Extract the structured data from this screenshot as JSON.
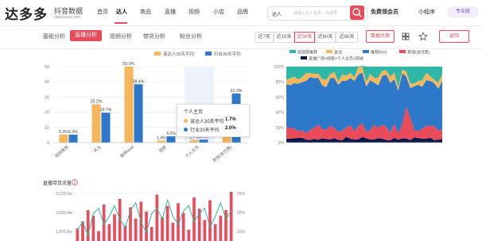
{
  "brand": {
    "name": "达多多",
    "sub": "抖音数据",
    "url": "daduoduo.com"
  },
  "nav": {
    "items": [
      {
        "label": "首页"
      },
      {
        "label": "达人"
      },
      {
        "label": "商品"
      },
      {
        "label": "直播"
      },
      {
        "label": "视频"
      },
      {
        "label": "小店"
      },
      {
        "label": "品牌"
      }
    ]
  },
  "search": {
    "type": "达人",
    "placeholder": "请输入达人名称、抖音号"
  },
  "header_right": {
    "vip": "免费领会员",
    "mini": "小程序",
    "pro": "专业版"
  },
  "tabs": [
    {
      "label": "基础分析"
    },
    {
      "label": "直播分析"
    },
    {
      "label": "视频分析"
    },
    {
      "label": "带货分析"
    },
    {
      "label": "粉丝分析"
    }
  ],
  "ranges": [
    {
      "label": "近7天"
    },
    {
      "label": "近15天"
    },
    {
      "label": "近30天"
    },
    {
      "label": "近60天"
    },
    {
      "label": "近90天"
    }
  ],
  "toolbar": {
    "bigscreen": "数据大屏",
    "return": "返回"
  },
  "colors": {
    "accent": "#e94b5b",
    "orange": "#f5b65c",
    "blue": "#2d78c8"
  },
  "tooltip": {
    "title": "个人主页",
    "rows": [
      {
        "name": "该达人30天平均",
        "value": "1.7%",
        "color": "#f5b65c"
      },
      {
        "name": "行业30天平均",
        "value": "2.0%",
        "color": "#2d78c8"
      }
    ]
  },
  "section": {
    "traffic_title": "直播带货流量",
    "watermark": "达多多"
  },
  "chart_data": [
    {
      "type": "bar",
      "legend": [
        "该达人30天平均",
        "行业30天平均"
      ],
      "categories": [
        "视频推荐",
        "关注",
        "推荐feed",
        "搜索",
        "个人主页",
        "其他(含付费)"
      ],
      "series": [
        {
          "name": "该达人30天平均",
          "values": [
            5.3,
            25.2,
            50.0,
            1.4,
            1.7,
            14.3
          ]
        },
        {
          "name": "行业30天平均",
          "values": [
            5.3,
            19.7,
            38.4,
            4.2,
            2.0,
            32.3
          ]
        }
      ],
      "labels": [
        [
          "5.3%",
          "25.2%",
          "50.0%",
          "1.4%",
          "1.7%",
          "14.3%"
        ],
        [
          "5.3%",
          "19.7%",
          "38.4%",
          "4.2%",
          "2.0%",
          "32.3%"
        ]
      ],
      "ylim": [
        0,
        50
      ],
      "yticks": [
        0,
        10,
        20,
        30,
        40,
        50
      ]
    },
    {
      "type": "area",
      "stacked": true,
      "yticks": [
        "0%",
        "20%",
        "40%",
        "60%",
        "80%",
        "100%"
      ],
      "series": [
        {
          "name": "直播广场",
          "color": "#0d1b4a"
        },
        {
          "name": "推荐feed",
          "color": "#e94b5b"
        },
        {
          "name": "其他",
          "color": "#2d78c8"
        },
        {
          "name": "关注",
          "color": "#f5b65c"
        },
        {
          "name": "视频推荐",
          "color": "#2fb7a8"
        }
      ],
      "legend_rows": [
        [
          "短视频推荐",
          "关注",
          "推荐feed",
          "其他(含付费)"
        ],
        [
          "直播广场+搜索+个人主页+同城"
        ]
      ]
    },
    {
      "type": "bar+line",
      "title": "直播带货流量",
      "y_left_ticks": [
        "3,129.0w",
        "2,502.4w",
        "1,876.8w"
      ],
      "y_right_ticks": [
        "25%",
        "20%",
        "15%"
      ],
      "bars": [
        9,
        14,
        22,
        18,
        7,
        26,
        12,
        19,
        30,
        11,
        24,
        16,
        28,
        21,
        10,
        33,
        17,
        25,
        13,
        27,
        20,
        8,
        31,
        23,
        15,
        29,
        12,
        18,
        22,
        35
      ],
      "line": [
        0.12,
        0.15,
        0.1,
        0.18,
        0.2,
        0.14,
        0.17,
        0.21,
        0.16,
        0.13,
        0.19,
        0.22,
        0.15,
        0.11,
        0.18,
        0.2,
        0.16,
        0.23,
        0.17,
        0.14,
        0.19,
        0.21,
        0.15,
        0.18,
        0.2,
        0.13,
        0.17,
        0.22,
        0.16,
        0.19
      ]
    }
  ]
}
